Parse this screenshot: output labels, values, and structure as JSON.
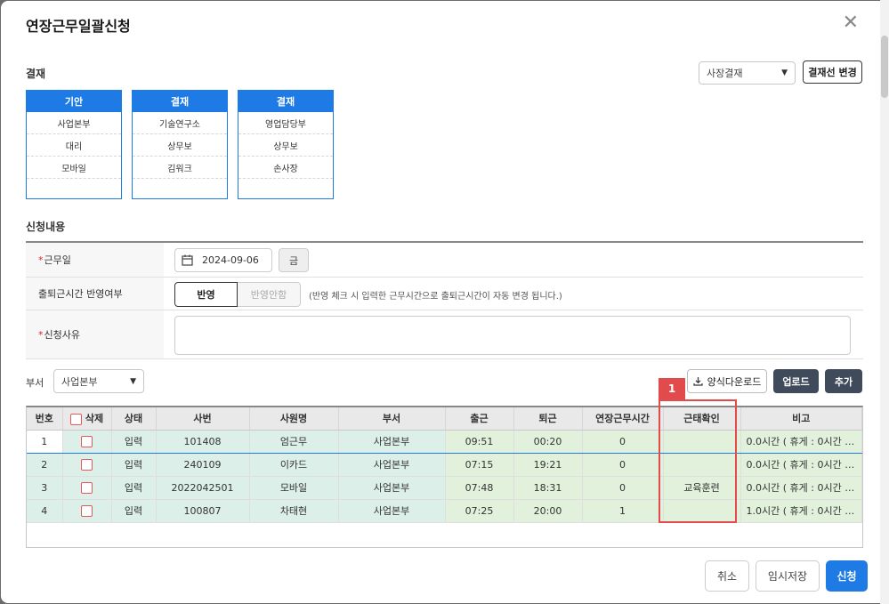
{
  "title": "연장근무일괄신청",
  "approval": {
    "label": "결재",
    "line_select": "사장결재",
    "change_button": "결재선 변경",
    "boxes": [
      {
        "head": "기안",
        "rows": [
          "사업본부",
          "대리",
          "모바일"
        ]
      },
      {
        "head": "결재",
        "rows": [
          "기술연구소",
          "상무보",
          "김워크"
        ]
      },
      {
        "head": "결재",
        "rows": [
          "영업담당부",
          "상무보",
          "손사장"
        ]
      }
    ]
  },
  "request": {
    "label": "신청내용",
    "work_date_label": "근무일",
    "work_date": "2024-09-06",
    "weekday": "금",
    "reflect_label": "출퇴근시간 반영여부",
    "reflect_on": "반영",
    "reflect_off": "반영안함",
    "reflect_note": "(반영 체크 시 입력한 근무시간으로 출퇴근시간이 자동 변경 됩니다.)",
    "reason_label": "신청사유",
    "reason_value": ""
  },
  "toolbar": {
    "dept_label": "부서",
    "dept_value": "사업본부",
    "download": "양식다운로드",
    "upload": "업로드",
    "add": "추가"
  },
  "grid": {
    "headers": [
      "번호",
      "삭제",
      "상태",
      "사번",
      "사원명",
      "부서",
      "출근",
      "퇴근",
      "연장근무시간",
      "근태확인",
      "비고"
    ],
    "rows": [
      {
        "no": "1",
        "status": "입력",
        "emp_id": "101408",
        "name": "엄근무",
        "dept": "사업본부",
        "in": "09:51",
        "out": "00:20",
        "overtime": "0",
        "attendance": "",
        "remark": "0.0시간 ( 휴게 : 0시간 …"
      },
      {
        "no": "2",
        "status": "입력",
        "emp_id": "240109",
        "name": "이카드",
        "dept": "사업본부",
        "in": "07:15",
        "out": "19:21",
        "overtime": "0",
        "attendance": "",
        "remark": "0.0시간 ( 휴게 : 0시간 …"
      },
      {
        "no": "3",
        "status": "입력",
        "emp_id": "2022042501",
        "name": "모바일",
        "dept": "사업본부",
        "in": "07:48",
        "out": "18:31",
        "overtime": "0",
        "attendance": "교육훈련",
        "remark": "0.0시간 ( 휴게 : 0시간 …"
      },
      {
        "no": "4",
        "status": "입력",
        "emp_id": "100807",
        "name": "차태현",
        "dept": "사업본부",
        "in": "07:25",
        "out": "20:00",
        "overtime": "1",
        "attendance": "",
        "remark": "1.0시간 ( 휴게 : 0시간 …"
      }
    ]
  },
  "highlight_number": "1",
  "footer": {
    "cancel": "취소",
    "draft": "임시저장",
    "submit": "신청"
  },
  "colors": {
    "primary": "#1e7be6",
    "highlight": "#e24b4b",
    "dark_button": "#3f4a5a"
  }
}
